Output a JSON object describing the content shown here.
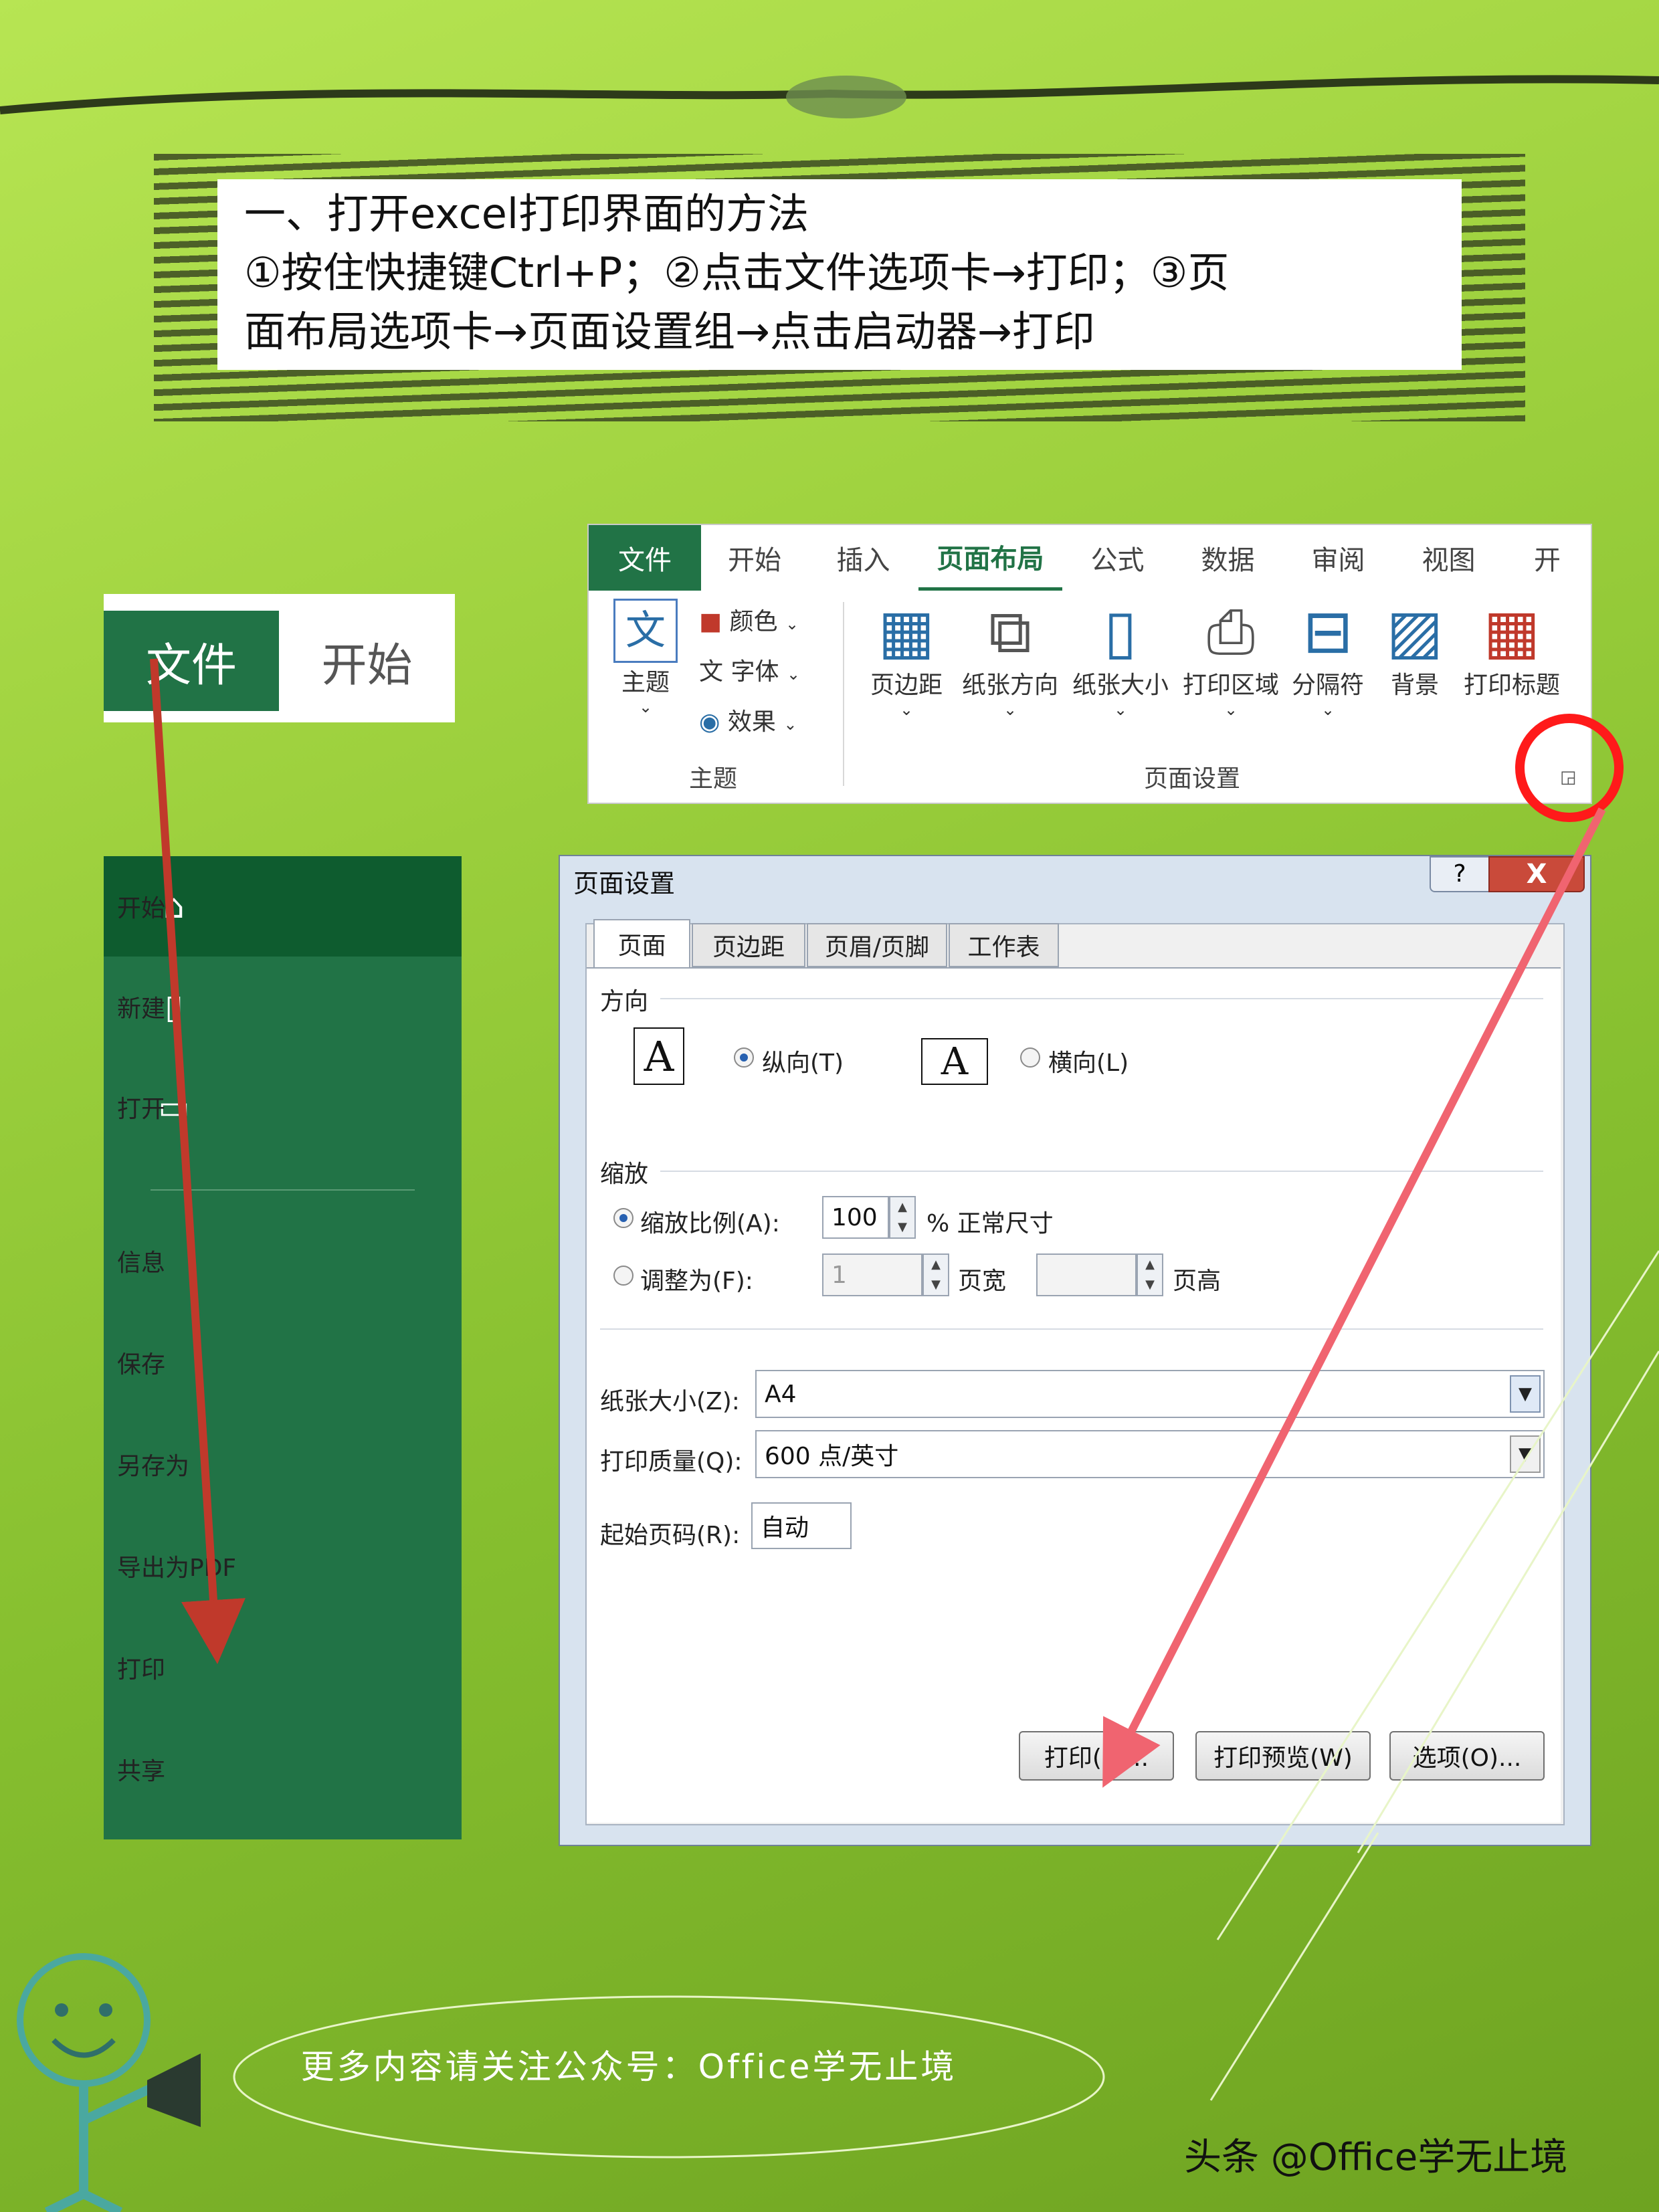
{
  "banner": {
    "line1": "一、打开excel打印界面的方法",
    "line2": "①按住快捷键Ctrl+P；②点击文件选项卡→打印；③页",
    "line3": "面布局选项卡→页面设置组→点击启动器→打印"
  },
  "file_crop": {
    "file": "文件",
    "home": "开始"
  },
  "backstage": {
    "items": [
      {
        "label": "开始",
        "icon": "home-icon"
      },
      {
        "label": "新建",
        "icon": "new-file-icon"
      },
      {
        "label": "打开",
        "icon": "open-folder-icon"
      },
      {
        "label": "信息"
      },
      {
        "label": "保存"
      },
      {
        "label": "另存为"
      },
      {
        "label": "导出为PDF"
      },
      {
        "label": "打印"
      },
      {
        "label": "共享"
      }
    ]
  },
  "ribbon": {
    "tabs": [
      "文件",
      "开始",
      "插入",
      "页面布局",
      "公式",
      "数据",
      "审阅",
      "视图",
      "开"
    ],
    "theme_group": {
      "theme": "主题",
      "colors": "颜色",
      "fonts": "字体",
      "effects": "效果",
      "group_label": "主题"
    },
    "page_setup": {
      "buttons": [
        "页边距",
        "纸张方向",
        "纸张大小",
        "打印区域",
        "分隔符",
        "背景",
        "打印标题"
      ],
      "group_label": "页面设置"
    }
  },
  "dialog": {
    "title": "页面设置",
    "help": "?",
    "close": "X",
    "tabs": [
      "页面",
      "页边距",
      "页眉/页脚",
      "工作表"
    ],
    "orientation": {
      "label": "方向",
      "portrait": "纵向(T)",
      "landscape": "横向(L)",
      "glyph": "A"
    },
    "scaling": {
      "label": "缩放",
      "adjust_to": "缩放比例(A):",
      "adjust_value": "100",
      "adjust_suffix": "% 正常尺寸",
      "fit_to": "调整为(F):",
      "fit_wide_value": "1",
      "fit_wide_suffix": "页宽",
      "fit_tall_value": "",
      "fit_tall_suffix": "页高"
    },
    "paper_size": {
      "label": "纸张大小(Z):",
      "value": "A4"
    },
    "print_quality": {
      "label": "打印质量(Q):",
      "value": "600 点/英寸"
    },
    "first_page": {
      "label": "起始页码(R):",
      "value": "自动"
    },
    "buttons": {
      "print": "打印(P)...",
      "preview": "打印预览(W)",
      "options": "选项(O)..."
    }
  },
  "footer": {
    "text": "更多内容请关注公众号：Office学无止境"
  },
  "watermark": {
    "text": "头条 @Office学无止境"
  },
  "colors": {
    "excel_green": "#217346",
    "arrow_red": "#e8505b",
    "background": "#9fd23f"
  }
}
